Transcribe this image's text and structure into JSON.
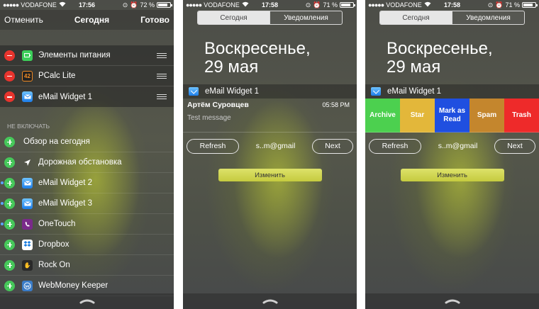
{
  "status": {
    "carrier": "VODAFONE",
    "phone1": {
      "time": "17:56",
      "battery": "72 %"
    },
    "phone2": {
      "time": "17:58",
      "battery": "71 %"
    },
    "phone3": {
      "time": "17:58",
      "battery": "71 %"
    }
  },
  "phone1": {
    "nav": {
      "cancel": "Отменить",
      "title": "Сегодня",
      "done": "Готово"
    },
    "enabled": [
      {
        "label": "Элементы питания",
        "icon": "battery-app-icon",
        "color": "#3ccf5a"
      },
      {
        "label": "PCalc Lite",
        "icon": "pcalc-app-icon",
        "color": "#222222",
        "glyph": "42"
      },
      {
        "label": "eMail Widget 1",
        "icon": "mail-app-icon",
        "color": "#2b8ef0"
      }
    ],
    "section_label": "НЕ ВКЛЮЧАТЬ",
    "disabled": [
      {
        "label": "Обзор на сегодня",
        "icon": "none",
        "dot": false
      },
      {
        "label": "Дорожная обстановка",
        "icon": "location-arrow-icon",
        "dot": false
      },
      {
        "label": "eMail Widget 2",
        "icon": "mail-app-icon",
        "dot": true
      },
      {
        "label": "eMail Widget 3",
        "icon": "mail-app-icon",
        "dot": true
      },
      {
        "label": "OneTouch",
        "icon": "onetouch-app-icon",
        "dot": true
      },
      {
        "label": "Dropbox",
        "icon": "dropbox-app-icon",
        "dot": false
      },
      {
        "label": "Rock On",
        "icon": "rockon-app-icon",
        "dot": false
      },
      {
        "label": "WebMoney Keeper",
        "icon": "webmoney-app-icon",
        "dot": false
      }
    ]
  },
  "today": {
    "tab_today": "Сегодня",
    "tab_notifications": "Уведомления",
    "date_line1": "Воскресенье,",
    "date_line2": "29 мая",
    "widget_title": "eMail Widget 1",
    "refresh": "Refresh",
    "account": "s..m@gmail",
    "next": "Next",
    "edit": "Изменить"
  },
  "phone2": {
    "sender": "Артём Суровцев",
    "time": "05:58 PM",
    "message": "Test message"
  },
  "phone3": {
    "actions": [
      {
        "label": "Archive",
        "color": "#4cd04f"
      },
      {
        "label": "Star",
        "color": "#e3b73a"
      },
      {
        "label": "Mark as Read",
        "color": "#1f4fe0"
      },
      {
        "label": "Spam",
        "color": "#c4862d"
      },
      {
        "label": "Trash",
        "color": "#ee2a2a"
      }
    ]
  }
}
